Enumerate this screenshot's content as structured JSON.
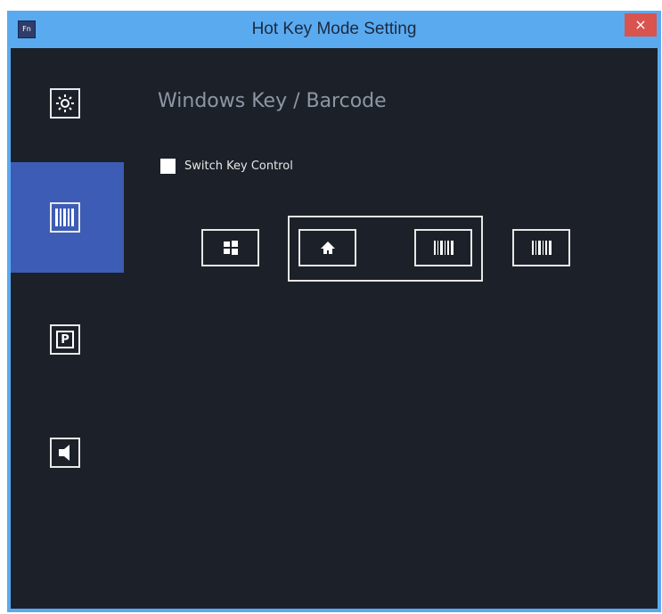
{
  "window": {
    "app_icon_text": "Fn",
    "title": "Hot Key Mode Setting",
    "close_symbol": "×",
    "titlebar_color": "#5aaaf0",
    "background_color": "#1c2129",
    "accent_color": "#3d5cb5"
  },
  "sidebar": {
    "items": [
      {
        "id": "brightness",
        "icon": "brightness-icon",
        "active": false
      },
      {
        "id": "barcode",
        "icon": "barcode-icon",
        "active": true
      },
      {
        "id": "p-key",
        "icon": "p-key-icon",
        "p_label": "P",
        "active": false
      },
      {
        "id": "volume",
        "icon": "speaker-icon",
        "active": false
      }
    ]
  },
  "main": {
    "title": "Windows Key / Barcode",
    "switch_key_control": {
      "label": "Switch Key Control",
      "checked": false
    },
    "keys": [
      {
        "id": "windows",
        "icon": "windows-icon"
      },
      {
        "id": "home",
        "icon": "home-icon",
        "grouped": true
      },
      {
        "id": "barcode-grouped",
        "icon": "barcode-icon",
        "grouped": true
      },
      {
        "id": "barcode",
        "icon": "barcode-icon"
      }
    ]
  }
}
